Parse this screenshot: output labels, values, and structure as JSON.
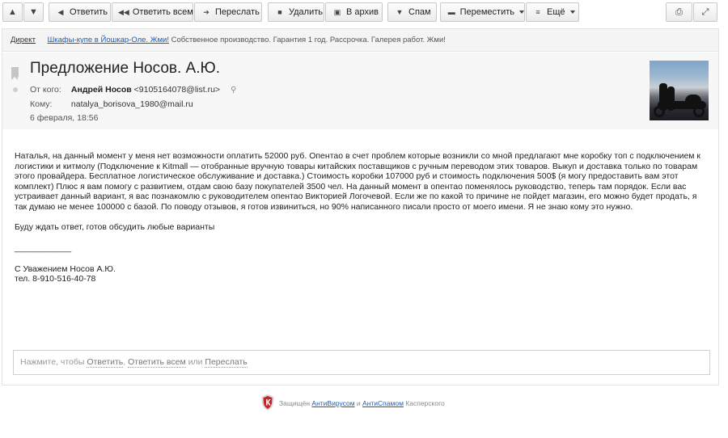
{
  "toolbar": {
    "up_icon": "arrow-up-icon",
    "down_icon": "arrow-down-icon",
    "reply": "Ответить",
    "reply_all": "Ответить всем",
    "forward": "Переслать",
    "delete": "Удалить",
    "archive": "В архив",
    "spam": "Спам",
    "move": "Переместить",
    "more": "Ещё",
    "print_icon": "print-icon",
    "expand_icon": "expand-icon"
  },
  "ad": {
    "tag": "Директ",
    "link": "Шкафы-купе в Йошкар-Оле. Жми!",
    "text": "Собственное производство. Гарантия 1 год. Рассрочка. Галерея работ. Жми!"
  },
  "message": {
    "subject": "Предложение Носов. А.Ю.",
    "from_label": "От кого:",
    "from_name": "Андрей Носов",
    "from_email": "<9105164078@list.ru>",
    "to_label": "Кому:",
    "to_email": "natalya_borisova_1980@mail.ru",
    "date": "6 февраля, 18:56",
    "body": [
      "Наталья, на данный момент у меня нет возможности оплатить 52000 руб. Опентао в счет проблем которые возникли со мной предлагают мне коробку топ с подключением к логистики и китмолу (Подключение к Kitmall — отобранные вручную товары китайских поставщиков с ручным переводом этих товаров. Выкуп и доставка только по товарам этого провайдера. Бесплатное логистическое обслуживание и доставка.) Стоимость коробки 107000 руб и стоимость подключения 500$ (я могу предоставить вам этот комплект) Плюс я вам помогу с развитием, отдам свою базу покупателей 3500 чел. На данный момент в опентао поменялось руководство, теперь там порядок. Если вас устраивает данный вариант, я вас познакомлю с руководителем опентао Викторией Логочевой. Если же по какой то причине не пойдет магазин, его можно будет продать, я так думаю не менее 100000 с базой. По поводу отзывов, я готов извиниться, но 90% написанного писали просто от моего имени. Я не знаю кому это нужно.",
      "Буду ждать ответ, готов обсудить любые варианты",
      "____________",
      "С Уважением Носов А.Ю.\nтел. 8-910-516-40-78"
    ]
  },
  "reply": {
    "prefix": "Нажмите, чтобы",
    "reply": "Ответить",
    "sep1": ",",
    "reply_all": "Ответить всем",
    "or": "или",
    "forward": "Переслать"
  },
  "footer": {
    "prefix": "Защищён",
    "antivirus": "АнтиВирусом",
    "and": "и",
    "antispam": "АнтиСпамом",
    "suffix": "Касперского"
  }
}
